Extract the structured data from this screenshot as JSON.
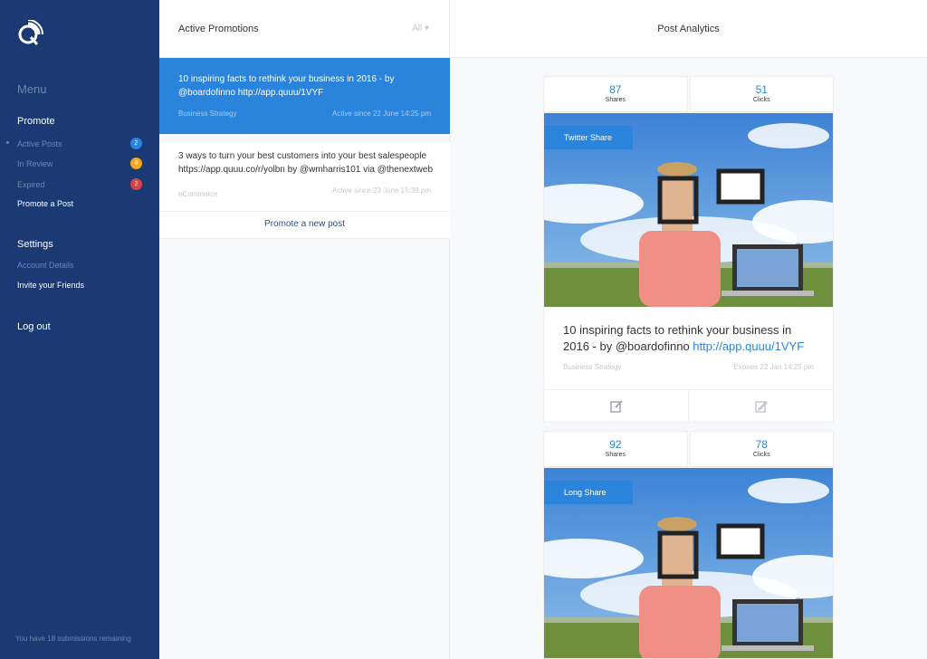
{
  "sidebar": {
    "menu_heading": "Menu",
    "promote_title": "Promote",
    "items": [
      {
        "label": "Active Posts",
        "badge": "2",
        "badge_color": "#2b84db"
      },
      {
        "label": "In Review",
        "badge": "4",
        "badge_color": "#f5a623"
      },
      {
        "label": "Expired",
        "badge": "2",
        "badge_color": "#d64545"
      },
      {
        "label": "Promote a Post"
      }
    ],
    "settings_title": "Settings",
    "settings_items": [
      {
        "label": "Account Details"
      },
      {
        "label": "Invite your Friends"
      }
    ],
    "logout": "Log out",
    "footer": "You have 18 submissions remaining"
  },
  "promotions": {
    "title": "Active Promotions",
    "filter": "All ▾",
    "items": [
      {
        "text": "10 inspiring facts to rethink your business in 2016 - by @boardofinno http://app.quuu/1VYF",
        "category": "Business Strategy",
        "since": "Active since 22 June 14:25 pm"
      },
      {
        "text": "3 ways to turn your best customers into your best salespeople https://app.quuu.co/r/yolbn by @wmharris101 via @thenextweb",
        "category": "eCommerce",
        "since": "Active since 23 June 15:39 pm"
      }
    ],
    "promote_new": "Promote a new post"
  },
  "analytics": {
    "title": "Post Analytics",
    "cards": [
      {
        "shares": "87",
        "shares_label": "Shares",
        "clicks": "51",
        "clicks_label": "Clicks",
        "tag": "Twitter Share",
        "text": "10 inspiring facts to rethink your business in 2016 - by @boardofinno ",
        "link": "http://app.quuu/1VYF",
        "category": "Business Strategy",
        "expires": "Expires 22 Jan 14:25 pm"
      },
      {
        "shares": "92",
        "shares_label": "Shares",
        "clicks": "78",
        "clicks_label": "Clicks",
        "tag": "Long Share"
      }
    ]
  }
}
